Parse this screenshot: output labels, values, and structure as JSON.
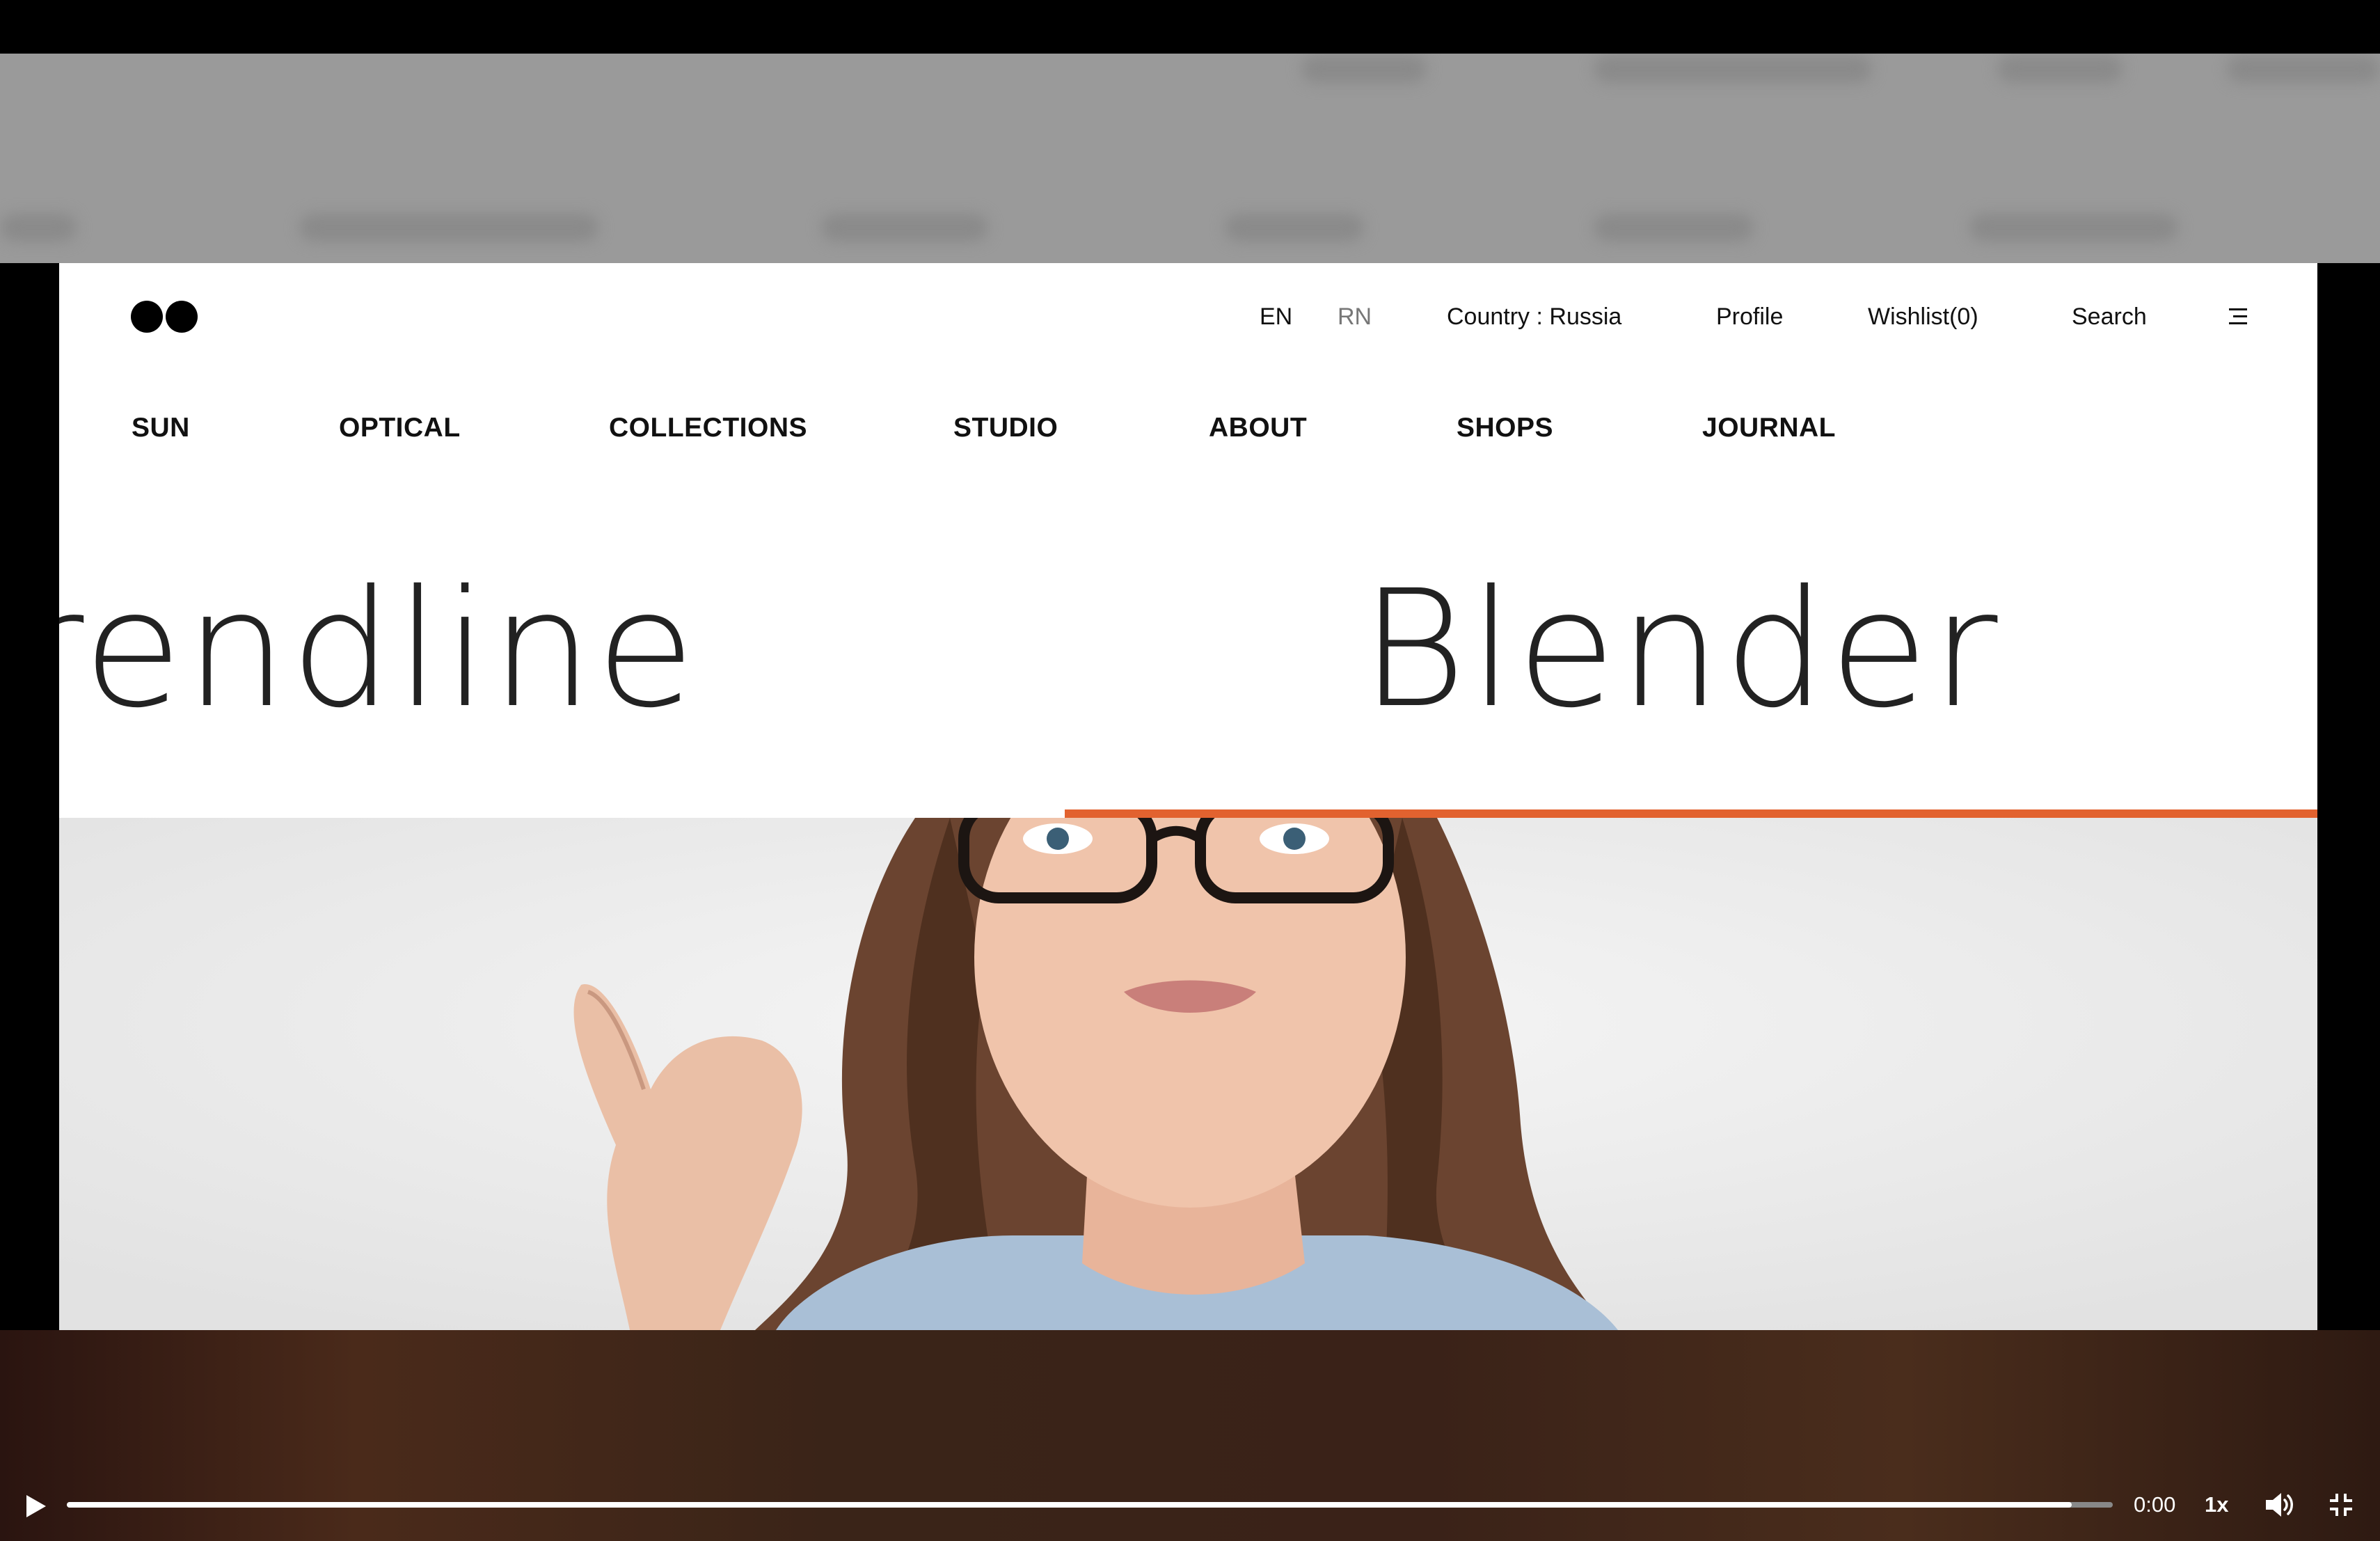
{
  "header": {
    "lang_en": "EN",
    "lang_rn": "RN",
    "country": "Country : Russia",
    "profile": "Profile",
    "wishlist": "Wishlist(0)",
    "search": "Search"
  },
  "nav": {
    "items": [
      "SUN",
      "OPTICAL",
      "COLLECTIONS",
      "STUDIO",
      "ABOUT",
      "SHOPS",
      "JOURNAL"
    ]
  },
  "hero": {
    "word_left": "rendline",
    "word_right": "Blender"
  },
  "video": {
    "time": "0:00",
    "rate": "1x",
    "progress": 0.98
  },
  "colors": {
    "accent": "#e2622f"
  },
  "icons": {
    "logo": "two-black-dots-logo",
    "menu": "hamburger-icon",
    "play": "play-icon",
    "volume": "volume-icon",
    "fullscreen": "exit-fullscreen-icon"
  }
}
